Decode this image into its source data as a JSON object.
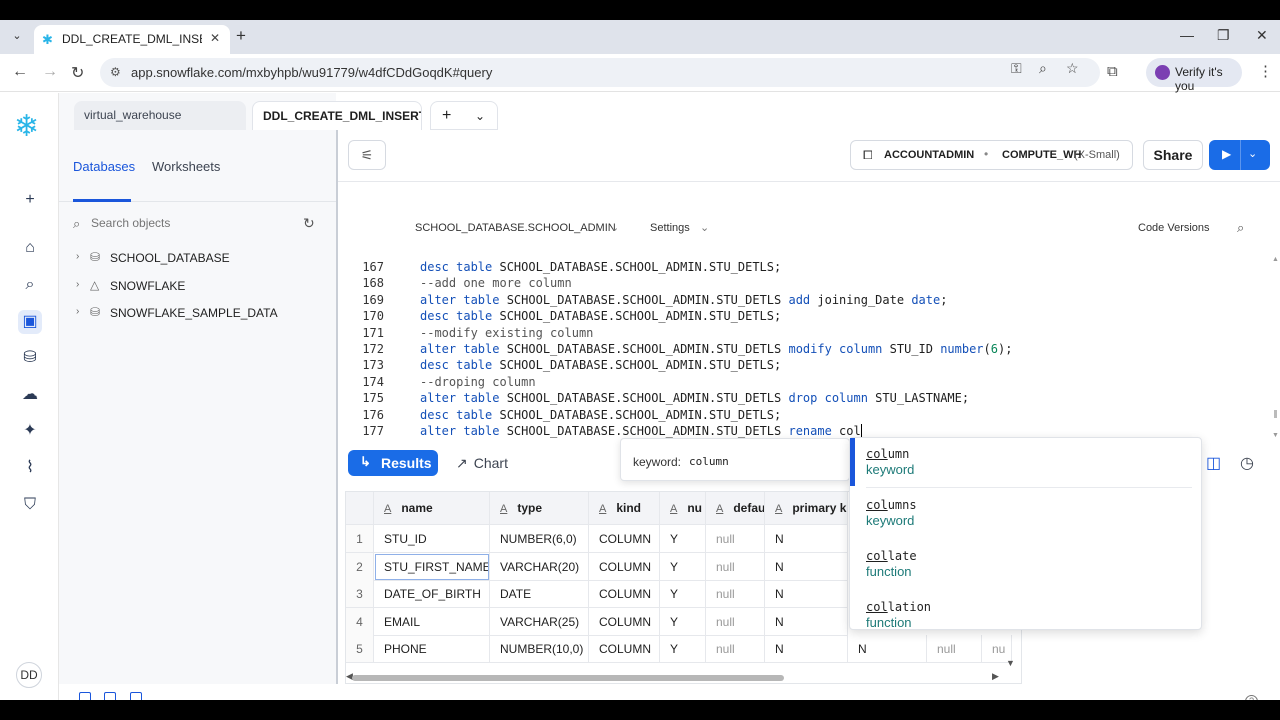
{
  "browser": {
    "tab_title": "DDL_CREATE_DML_INSERT_DRL",
    "url": "app.snowflake.com/mxbyhpb/wu91779/w4dfCDdGoqdK#query",
    "profile_label": "Verify it's you",
    "win_minimize": "—",
    "win_restore": "❐",
    "win_close": "✕",
    "new_tab": "+",
    "tab_close": "✕"
  },
  "leftnav": {
    "avatar": "DD",
    "icons": [
      "add-icon",
      "home-icon",
      "search-icon",
      "worksheet-icon",
      "database-icon",
      "cloud-icon",
      "ai-sparkle-icon",
      "activity-icon",
      "shield-icon"
    ]
  },
  "worksheet_tabs": [
    {
      "label": "virtual_warehouse"
    },
    {
      "label": "DDL_CREATE_DML_INSERT..."
    }
  ],
  "object_panel": {
    "tabs": [
      "Databases",
      "Worksheets"
    ],
    "search_placeholder": "Search objects",
    "databases": [
      "SCHOOL_DATABASE",
      "SNOWFLAKE",
      "SNOWFLAKE_SAMPLE_DATA"
    ]
  },
  "header": {
    "role": "ACCOUNTADMIN",
    "warehouse": "COMPUTE_WH",
    "warehouse_size": "(X-Small)",
    "share_label": "Share"
  },
  "editor": {
    "context": "SCHOOL_DATABASE.SCHOOL_ADMIN",
    "settings_label": "Settings",
    "code_versions_label": "Code Versions",
    "lines": [
      {
        "n": "167",
        "parts": [
          [
            "kw",
            "desc table"
          ],
          [
            "t",
            " SCHOOL_DATABASE.SCHOOL_ADMIN.STU_DETLS;"
          ]
        ]
      },
      {
        "n": "168",
        "parts": [
          [
            "cm",
            "--add one more column"
          ]
        ]
      },
      {
        "n": "169",
        "parts": [
          [
            "kw",
            "alter table"
          ],
          [
            "t",
            " SCHOOL_DATABASE.SCHOOL_ADMIN.STU_DETLS "
          ],
          [
            "kw",
            "add"
          ],
          [
            "t",
            " joining_Date "
          ],
          [
            "kw",
            "date"
          ],
          [
            "t",
            ";"
          ]
        ]
      },
      {
        "n": "170",
        "parts": [
          [
            "kw",
            "desc table"
          ],
          [
            "t",
            " SCHOOL_DATABASE.SCHOOL_ADMIN.STU_DETLS;"
          ]
        ]
      },
      {
        "n": "171",
        "parts": [
          [
            "cm",
            "--modify existing column"
          ]
        ]
      },
      {
        "n": "172",
        "parts": [
          [
            "kw",
            "alter table"
          ],
          [
            "t",
            " SCHOOL_DATABASE.SCHOOL_ADMIN.STU_DETLS "
          ],
          [
            "kw",
            "modify column"
          ],
          [
            "t",
            " STU_ID "
          ],
          [
            "kw",
            "number"
          ],
          [
            "t",
            "("
          ],
          [
            "num",
            "6"
          ],
          [
            "t",
            ");"
          ]
        ]
      },
      {
        "n": "173",
        "parts": [
          [
            "kw",
            "desc table"
          ],
          [
            "t",
            " SCHOOL_DATABASE.SCHOOL_ADMIN.STU_DETLS;"
          ]
        ]
      },
      {
        "n": "174",
        "parts": [
          [
            "cm",
            "--droping column"
          ]
        ]
      },
      {
        "n": "175",
        "parts": [
          [
            "kw",
            "alter table"
          ],
          [
            "t",
            " SCHOOL_DATABASE.SCHOOL_ADMIN.STU_DETLS "
          ],
          [
            "kw",
            "drop column"
          ],
          [
            "t",
            " STU_LASTNAME;"
          ]
        ]
      },
      {
        "n": "176",
        "parts": [
          [
            "kw",
            "desc table"
          ],
          [
            "t",
            " SCHOOL_DATABASE.SCHOOL_ADMIN.STU_DETLS;"
          ]
        ]
      },
      {
        "n": "177",
        "parts": [
          [
            "kw",
            "alter table"
          ],
          [
            "t",
            " SCHOOL_DATABASE.SCHOOL_ADMIN.STU_DETLS "
          ],
          [
            "kw",
            "rename"
          ],
          [
            "t",
            " col"
          ],
          [
            "cursor",
            ""
          ]
        ]
      }
    ]
  },
  "results": {
    "results_label": "Results",
    "chart_label": "Chart",
    "columns": [
      "name",
      "type",
      "kind",
      "nu",
      "defau",
      "primary k"
    ],
    "rows": [
      {
        "i": "1",
        "name": "STU_ID",
        "type": "NUMBER(6,0)",
        "kind": "COLUMN",
        "null": "Y",
        "default": "null",
        "pk": "N"
      },
      {
        "i": "2",
        "name": "STU_FIRST_NAME",
        "type": "VARCHAR(20)",
        "kind": "COLUMN",
        "null": "Y",
        "default": "null",
        "pk": "N"
      },
      {
        "i": "3",
        "name": "DATE_OF_BIRTH",
        "type": "DATE",
        "kind": "COLUMN",
        "null": "Y",
        "default": "null",
        "pk": "N"
      },
      {
        "i": "4",
        "name": "EMAIL",
        "type": "VARCHAR(25)",
        "kind": "COLUMN",
        "null": "Y",
        "default": "null",
        "pk": "N"
      },
      {
        "i": "5",
        "name": "PHONE",
        "type": "NUMBER(10,0)",
        "kind": "COLUMN",
        "null": "Y",
        "default": "null",
        "pk": "N"
      }
    ],
    "row5_extra": {
      "n": "N",
      "null": "null",
      "nu": "nu"
    }
  },
  "autocomplete": {
    "tooltip_key": "keyword:",
    "tooltip_value": "column",
    "suggestions": [
      {
        "match": "col",
        "rest": "umn",
        "category": "keyword"
      },
      {
        "match": "col",
        "rest": "umns",
        "category": "keyword"
      },
      {
        "match": "col",
        "rest": "late",
        "category": "function"
      },
      {
        "match": "col",
        "rest": "lation",
        "category": "function"
      }
    ]
  }
}
